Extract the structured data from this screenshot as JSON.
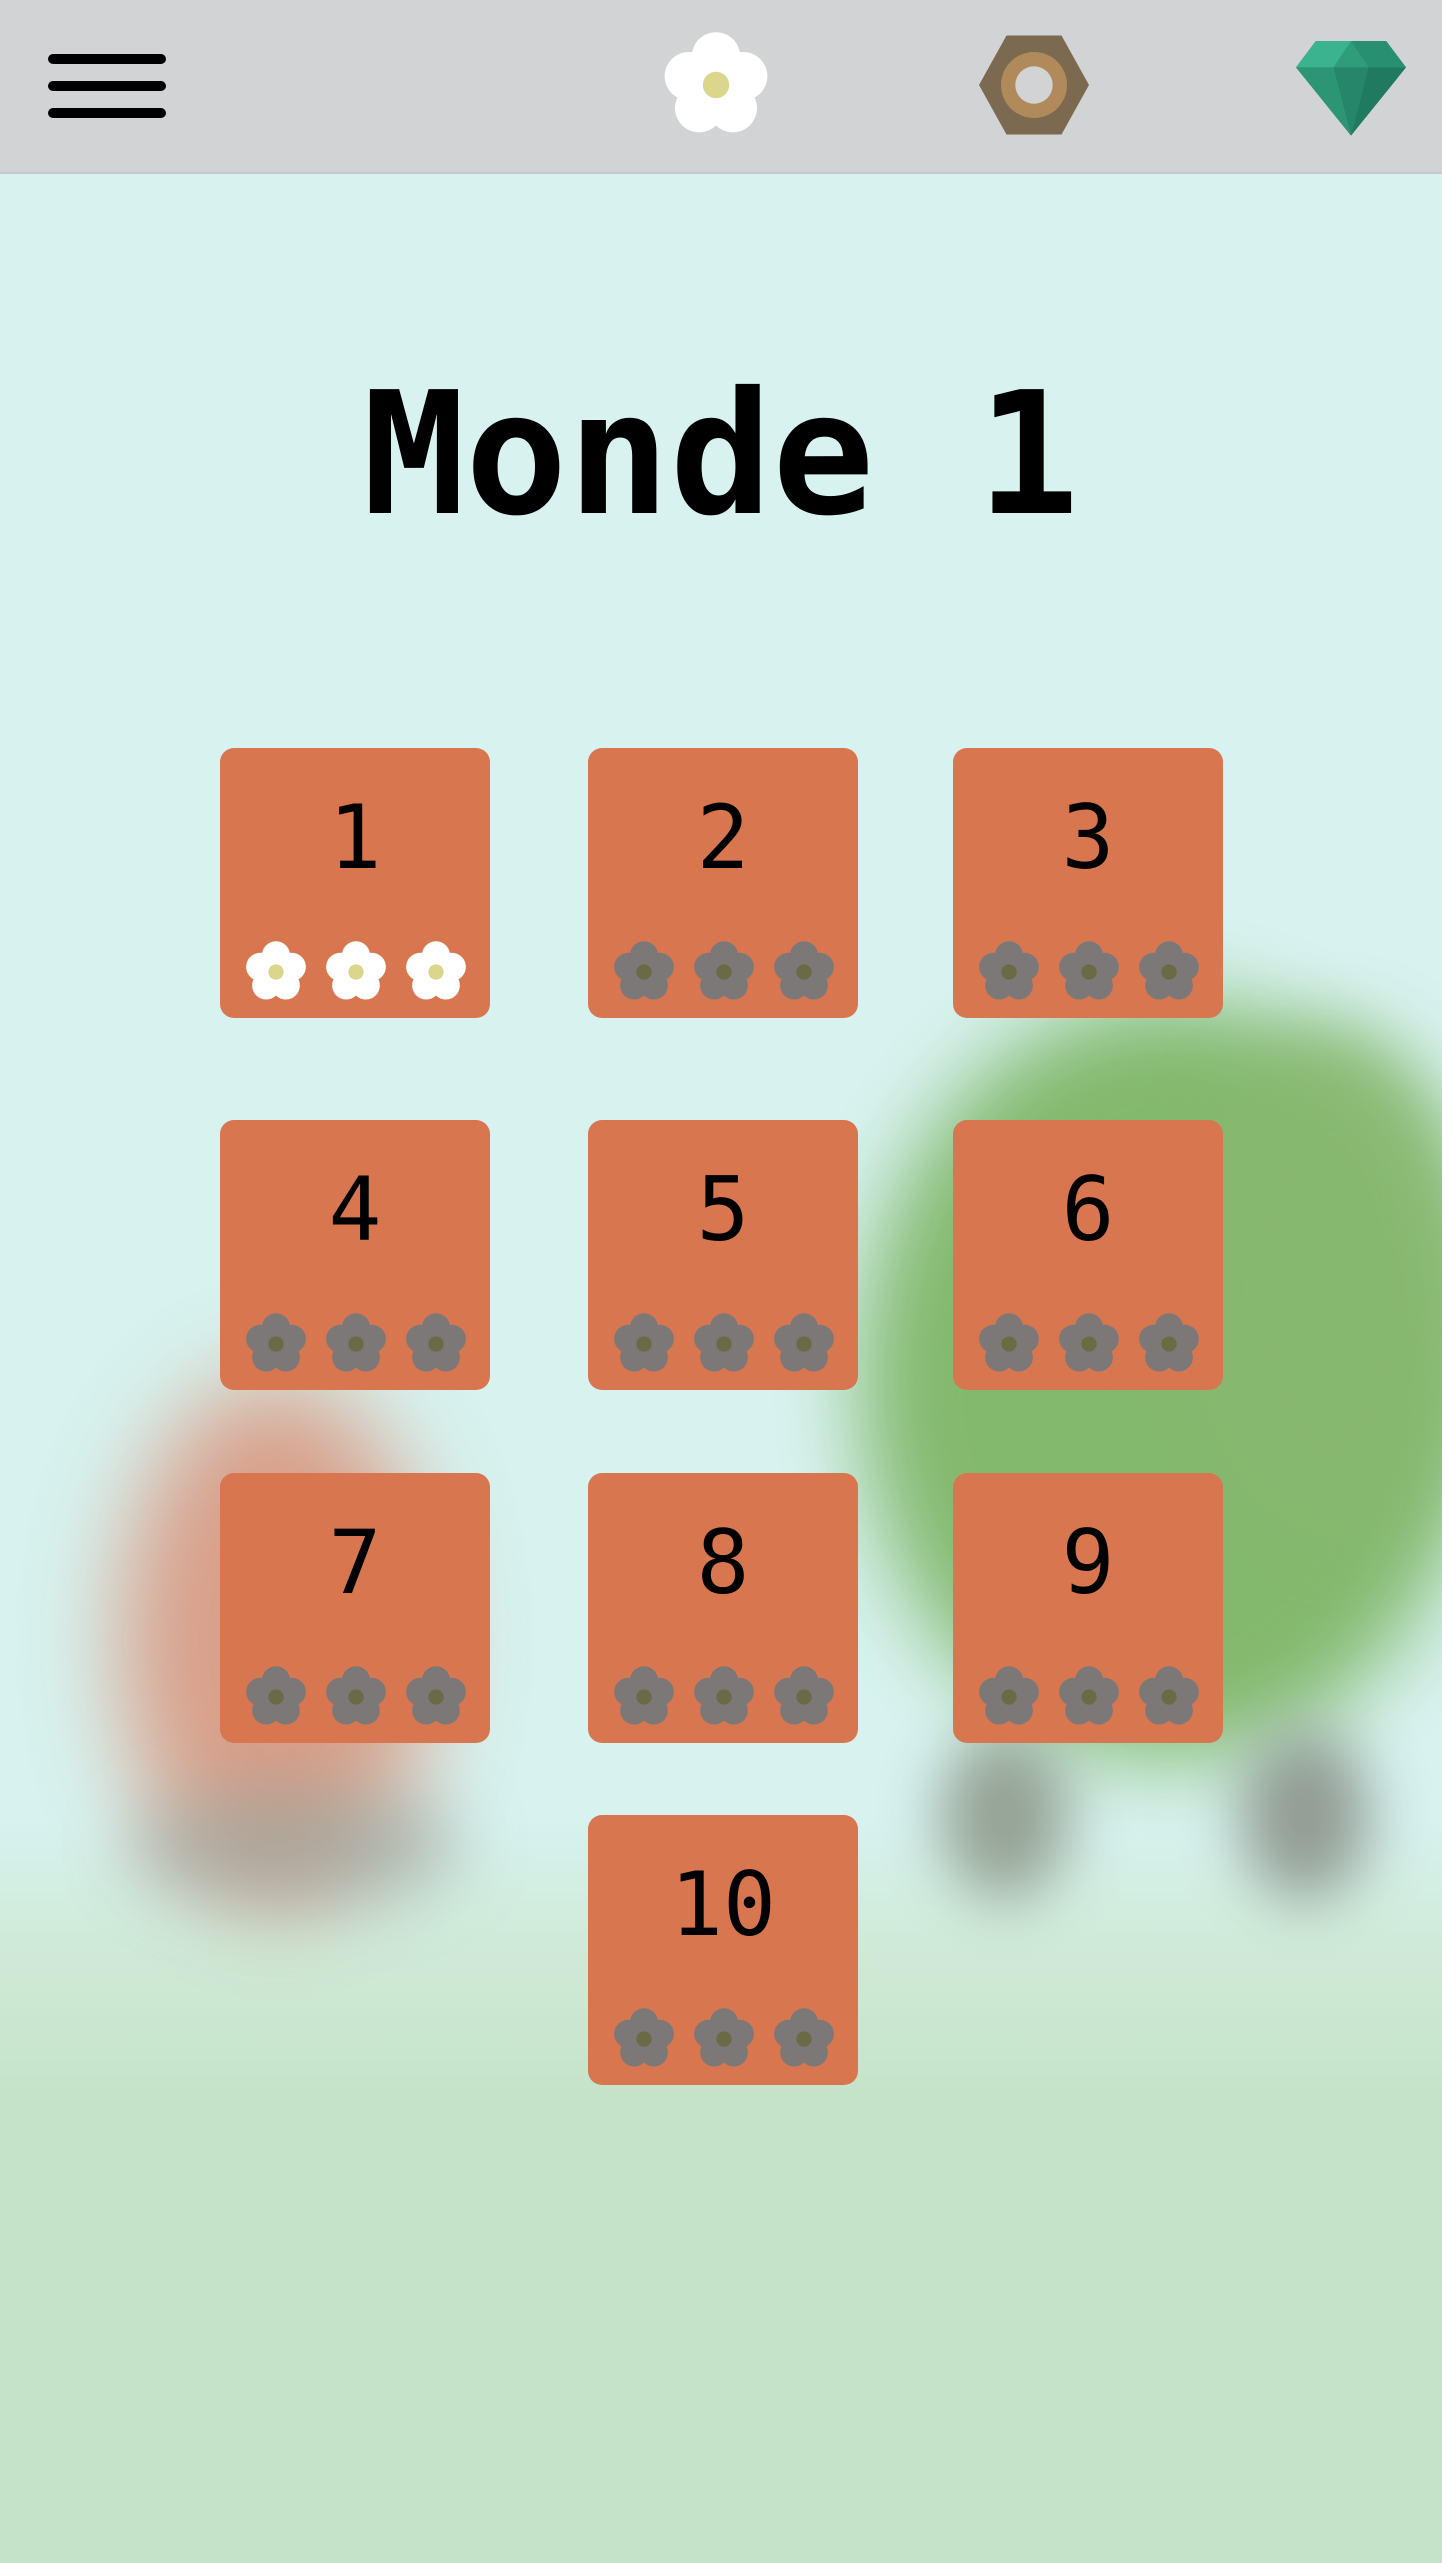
{
  "header": {
    "menu_icon": "hamburger-menu-icon",
    "flower_icon": "flower-icon",
    "nut_icon": "hex-nut-icon",
    "gem_icon": "emerald-gem-icon"
  },
  "title": "Monde 1",
  "colors": {
    "background": "#d7f2ef",
    "topbar": "#d2d3d5",
    "tile": "#d87650",
    "flower_earned": "#ffffff",
    "flower_center_earned": "#dcd68c",
    "flower_locked": "#7d7878",
    "flower_center_locked": "#6a6b45",
    "nut": "#7b6a4f",
    "gem": "#2f9c7a"
  },
  "levels": [
    {
      "number": "1",
      "flowers_earned": 3,
      "flowers_total": 3
    },
    {
      "number": "2",
      "flowers_earned": 0,
      "flowers_total": 3
    },
    {
      "number": "3",
      "flowers_earned": 0,
      "flowers_total": 3
    },
    {
      "number": "4",
      "flowers_earned": 0,
      "flowers_total": 3
    },
    {
      "number": "5",
      "flowers_earned": 0,
      "flowers_total": 3
    },
    {
      "number": "6",
      "flowers_earned": 0,
      "flowers_total": 3
    },
    {
      "number": "7",
      "flowers_earned": 0,
      "flowers_total": 3
    },
    {
      "number": "8",
      "flowers_earned": 0,
      "flowers_total": 3
    },
    {
      "number": "9",
      "flowers_earned": 0,
      "flowers_total": 3
    },
    {
      "number": "10",
      "flowers_earned": 0,
      "flowers_total": 3
    }
  ]
}
